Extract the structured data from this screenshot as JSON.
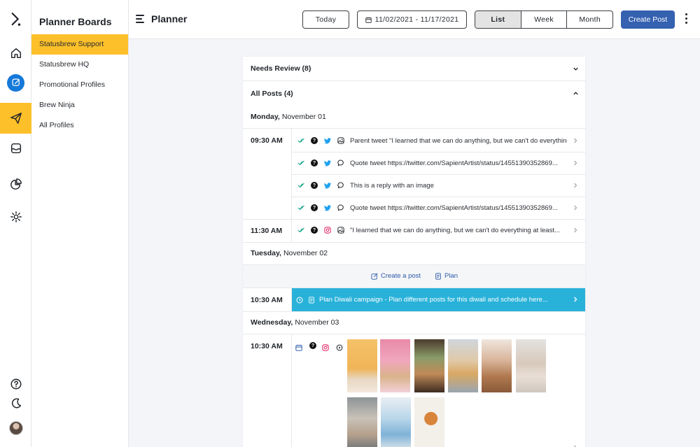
{
  "app": {
    "title": "Planner"
  },
  "sidebar": {
    "title": "Planner Boards",
    "items": [
      {
        "label": "Statusbrew Support",
        "active": true
      },
      {
        "label": "Statusbrew HQ"
      },
      {
        "label": "Promotional Profiles"
      },
      {
        "label": "Brew Ninja"
      },
      {
        "label": "All Profiles"
      }
    ]
  },
  "rail": {
    "items": [
      "logo-icon",
      "home-icon",
      "planner-icon",
      "publish-icon",
      "inbox-icon",
      "reports-icon",
      "settings-icon"
    ],
    "bottom": [
      "help-icon",
      "dark-mode-icon",
      "avatar"
    ]
  },
  "toolbar": {
    "today_label": "Today",
    "date_range": "11/02/2021 - 11/17/2021",
    "views": [
      "List",
      "Week",
      "Month"
    ],
    "active_view": "List",
    "create_label": "Create Post"
  },
  "sections": {
    "needs_review": "Needs Review (8)",
    "all_posts": "All Posts (4)"
  },
  "days": [
    {
      "weekday": "Monday,",
      "date": "November 01",
      "slots": [
        {
          "time": "09:30 AM",
          "posts": [
            {
              "network": "twitter",
              "type": "parent",
              "text": "Parent tweet \"I learned that we can do anything, but we can't do everything..."
            },
            {
              "network": "twitter",
              "type": "quote",
              "text": "Quote tweet https://twitter.com/SapientArtist/status/14551390352869..."
            },
            {
              "network": "twitter",
              "type": "reply",
              "text": "This is a reply with an image"
            },
            {
              "network": "twitter",
              "type": "quote",
              "text": "Quote tweet https://twitter.com/SapientArtist/status/14551390352869..."
            }
          ]
        },
        {
          "time": "11:30 AM",
          "posts": [
            {
              "network": "instagram",
              "type": "image",
              "text": "\"I learned that we can do anything, but we can't do everything at least..."
            }
          ]
        }
      ]
    },
    {
      "weekday": "Tuesday,",
      "date": "November 02",
      "actions": {
        "create": "Create a post",
        "plan": "Plan"
      },
      "slots": [
        {
          "time": "10:30 AM",
          "plan_text": "Plan Diwali campaign - Plan different posts for this diwali and schedule here..."
        }
      ]
    },
    {
      "weekday": "Wednesday,",
      "date": "November 03",
      "slots": [
        {
          "time": "10:30 AM",
          "network": "instagram",
          "media_count": 9
        }
      ]
    }
  ],
  "colors": {
    "accent_yellow": "#fdc02a",
    "primary_blue": "#3461b0",
    "plan_cyan": "#29b2d9",
    "twitter_blue": "#1da1f2",
    "instagram_pink": "#e1306c",
    "approved_green": "#1aa88c"
  }
}
